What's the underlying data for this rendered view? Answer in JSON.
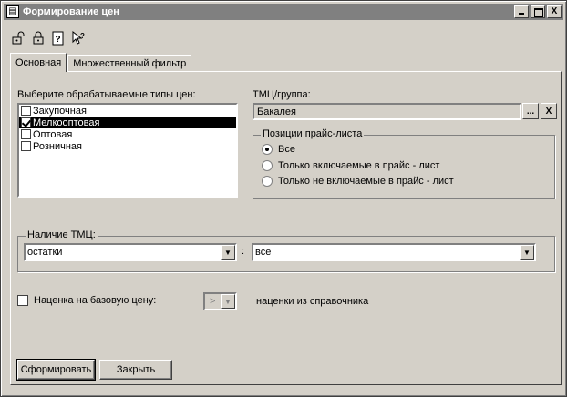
{
  "window": {
    "title": "Формирование цен",
    "controls": [
      "_",
      "□",
      "X"
    ]
  },
  "toolbar": {
    "icons": [
      "lock-open-icon",
      "lock-icon",
      "help-icon",
      "context-help-icon"
    ]
  },
  "tabs": [
    {
      "label": "Основная",
      "active": true
    },
    {
      "label": "Множественный фильтр",
      "active": false
    }
  ],
  "price_types": {
    "label": "Выберите обрабатываемые типы цен:",
    "items": [
      {
        "label": "Закупочная",
        "checked": false,
        "selected": false
      },
      {
        "label": "Мелкооптовая",
        "checked": true,
        "selected": true
      },
      {
        "label": "Оптовая",
        "checked": false,
        "selected": false
      },
      {
        "label": "Розничная",
        "checked": false,
        "selected": false
      }
    ]
  },
  "goods_group": {
    "label": "ТМЦ/группа:",
    "value": "Бакалея",
    "browse_label": "...",
    "clear_label": "X"
  },
  "pricelist": {
    "legend": "Позиции прайс-листа",
    "options": [
      {
        "label": "Все",
        "selected": true
      },
      {
        "label": "Только включаемые в прайс - лист",
        "selected": false
      },
      {
        "label": "Только не включаемые в прайс - лист",
        "selected": false
      }
    ]
  },
  "availability": {
    "legend": "Наличие ТМЦ:",
    "left_value": "остатки",
    "separator": ":",
    "right_value": "все"
  },
  "markup": {
    "checkbox_label": "Наценка на базовую цену:",
    "checked": false,
    "operator": ">",
    "source_label": "наценки из справочника"
  },
  "buttons": {
    "generate": "Сформировать",
    "close": "Закрыть"
  },
  "colors": {
    "face": "#d4d0c8",
    "title_bar": "#808080",
    "selection": "#000000"
  }
}
